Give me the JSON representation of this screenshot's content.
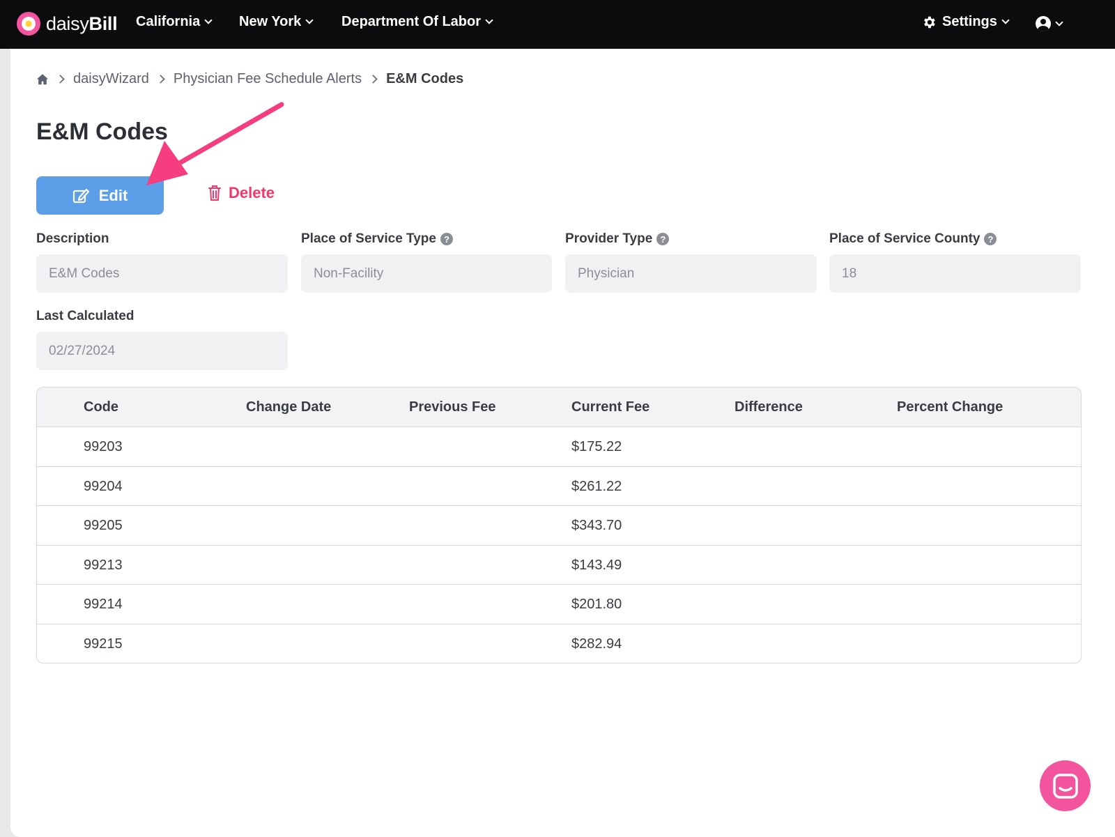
{
  "nav": {
    "brand_light": "daisy",
    "brand_bold": "Bill",
    "items": [
      {
        "label": "California"
      },
      {
        "label": "New York"
      },
      {
        "label": "Department Of Labor"
      }
    ],
    "settings_label": "Settings",
    "icons": {
      "settings": "gear-icon",
      "user": "user-circle-icon",
      "chevron": "chevron-down-icon"
    }
  },
  "breadcrumb": {
    "home_icon": "home-icon",
    "items": [
      "daisyWizard",
      "Physician Fee Schedule Alerts"
    ],
    "current": "E&M Codes"
  },
  "page": {
    "title": "E&M Codes",
    "edit_label": "Edit",
    "delete_label": "Delete"
  },
  "fields": {
    "description": {
      "label": "Description",
      "value": "E&M Codes"
    },
    "place_of_service_type": {
      "label": "Place of Service Type",
      "value": "Non-Facility"
    },
    "provider_type": {
      "label": "Provider Type",
      "value": "Physician"
    },
    "place_of_service_county": {
      "label": "Place of Service County",
      "value": "18"
    },
    "last_calculated": {
      "label": "Last Calculated",
      "value": "02/27/2024"
    }
  },
  "table": {
    "headers": [
      "Code",
      "Change Date",
      "Previous Fee",
      "Current Fee",
      "Difference",
      "Percent Change"
    ],
    "rows": [
      {
        "code": "99203",
        "current_fee": "$175.22"
      },
      {
        "code": "99204",
        "current_fee": "$261.22"
      },
      {
        "code": "99205",
        "current_fee": "$343.70"
      },
      {
        "code": "99213",
        "current_fee": "$143.49"
      },
      {
        "code": "99214",
        "current_fee": "$201.80"
      },
      {
        "code": "99215",
        "current_fee": "$282.94"
      }
    ]
  },
  "colors": {
    "nav_bg": "#0c0c0e",
    "brand_pink": "#f2549d",
    "edit_blue": "#5c9ee8",
    "delete_red": "#f0386d",
    "annotation_arrow": "#f53d7f"
  }
}
